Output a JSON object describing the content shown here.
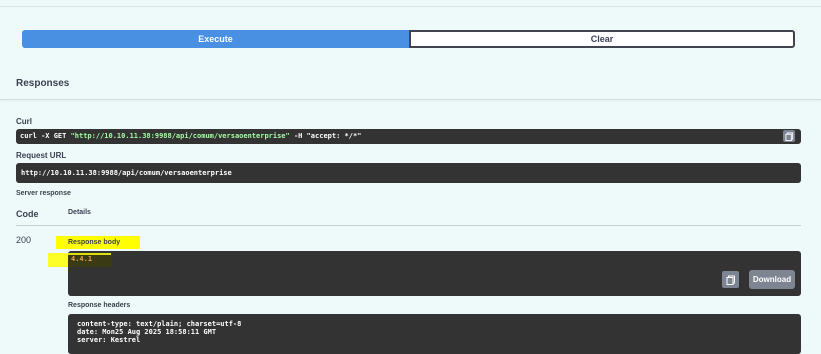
{
  "buttons": {
    "execute": "Execute",
    "clear": "Clear"
  },
  "responses_title": "Responses",
  "curl": {
    "label": "Curl",
    "prefix": "curl -X GET ",
    "url": "\"http://10.10.11.38:9988/api/comum/versaoenterprise\"",
    "suffix": " -H  \"accept: */*\""
  },
  "request_url": {
    "label": "Request URL",
    "value": "http://10.10.11.38:9988/api/comum/versaoenterprise"
  },
  "server_response": {
    "label": "Server response",
    "col_code": "Code",
    "col_details": "Details",
    "status": "200",
    "body_label": "Response body",
    "body_value": "4.4.1",
    "download": "Download",
    "headers_label": "Response headers",
    "headers": [
      "content-type: text/plain; charset=utf-8",
      "date: Mon25 Aug 2025 18:58:11 GMT",
      "server: Kestrel"
    ]
  },
  "colors": {
    "execute_bg": "#4990e2",
    "code_bg": "#333333",
    "highlight": "#ffff00",
    "body_text": "#e6a34b"
  }
}
